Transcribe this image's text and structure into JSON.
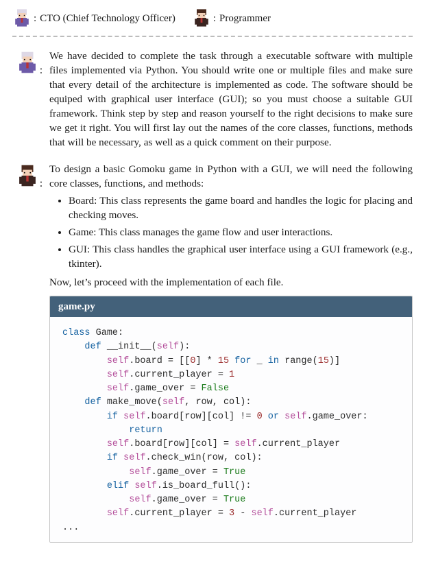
{
  "legend": {
    "role1_label": "CTO (Chief Technology Officer)",
    "role2_label": "Programmer"
  },
  "dialog": {
    "cto_paragraph": "We have decided to complete the task through a executable software with multiple files implemented via Python. You should write one or multiple files and make sure that every detail of the architecture is implemented as code. The software should be equiped with graphical user interface (GUI); so you must choose a suitable GUI framework. Think step by step and reason yourself to the right decisions to make sure we get it right. You will first lay out the names of the core classes, functions, methods that will be necessary, as well as a quick comment on their purpose.",
    "programmer_intro": "To design a basic Gomoku game in Python with a GUI, we will need the following core classes, functions, and methods:",
    "bullets": {
      "b1": "Board: This class represents the game board and handles the logic for placing and checking moves.",
      "b2": "Game: This class manages the game flow and user interactions.",
      "b3": "GUI: This class handles the graphical user interface using a GUI framework (e.g., tkinter)."
    },
    "programmer_outro": "Now, let’s proceed with the implementation of each file."
  },
  "code": {
    "filename": "game.py",
    "raw": "class Game:\n    def __init__(self):\n        self.board = [[0] * 15 for _ in range(15)]\n        self.current_player = 1\n        self.game_over = False\n    def make_move(self, row, col):\n        if self.board[row][col] != 0 or self.game_over:\n            return\n        self.board[row][col] = self.current_player\n        if self.check_win(row, col):\n            self.game_over = True\n        elif self.is_board_full():\n            self.game_over = True\n        self.current_player = 3 - self.current_player\n..."
  },
  "avatars": {
    "cto": {
      "hair": "#ded8e6",
      "coat": "#6d5aa8",
      "tie": "#b33",
      "skin": "#f3d1b8"
    },
    "prog": {
      "hair": "#4a2b1f",
      "coat": "#3a2420",
      "tie": "#b33",
      "skin": "#f3d1b8"
    }
  }
}
